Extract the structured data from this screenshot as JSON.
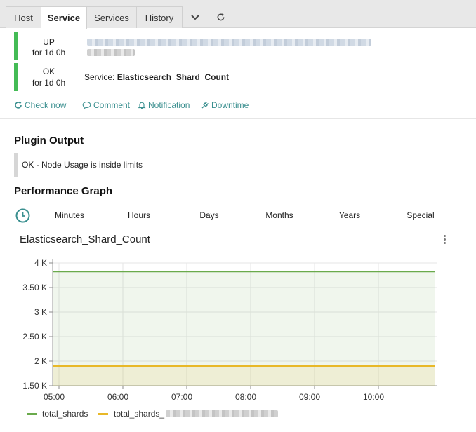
{
  "tabs": [
    {
      "label": "Host",
      "active": false
    },
    {
      "label": "Service",
      "active": true
    },
    {
      "label": "Services",
      "active": false
    },
    {
      "label": "History",
      "active": false
    }
  ],
  "host_status": {
    "state": "UP",
    "duration": "for 1d 0h",
    "color": "#44bb55"
  },
  "service_status": {
    "state": "OK",
    "duration": "for 1d 0h",
    "prefix": "Service:",
    "name": "Elasticsearch_Shard_Count",
    "color": "#44bb55"
  },
  "actions": {
    "check_now": "Check now",
    "comment": "Comment",
    "notification": "Notification",
    "downtime": "Downtime",
    "color": "#3a8f8f"
  },
  "plugin_output": {
    "heading": "Plugin Output",
    "text": "OK - Node Usage is inside limits"
  },
  "performance": {
    "heading": "Performance Graph",
    "ranges": [
      "Minutes",
      "Hours",
      "Days",
      "Months",
      "Years",
      "Special"
    ]
  },
  "chart_data": {
    "type": "area",
    "title": "Elasticsearch_Shard_Count",
    "x": [
      "05:00",
      "06:00",
      "07:00",
      "08:00",
      "09:00",
      "10:00"
    ],
    "xlabel": "",
    "ylabel": "",
    "ylim": [
      1500,
      4000
    ],
    "y_ticks": [
      "1.50 K",
      "2 K",
      "2.50 K",
      "3 K",
      "3.50 K",
      "4 K"
    ],
    "grid": true,
    "legend_placement": "bottom-left",
    "series": [
      {
        "name": "total_shards",
        "color": "#6aaa4c",
        "values": [
          3820,
          3820,
          3820,
          3820,
          3820,
          3820,
          3820
        ]
      },
      {
        "name": "total_shards_",
        "color": "#e8b828",
        "values": [
          1900,
          1900,
          1900,
          1900,
          1900,
          1900,
          1900
        ]
      }
    ]
  }
}
